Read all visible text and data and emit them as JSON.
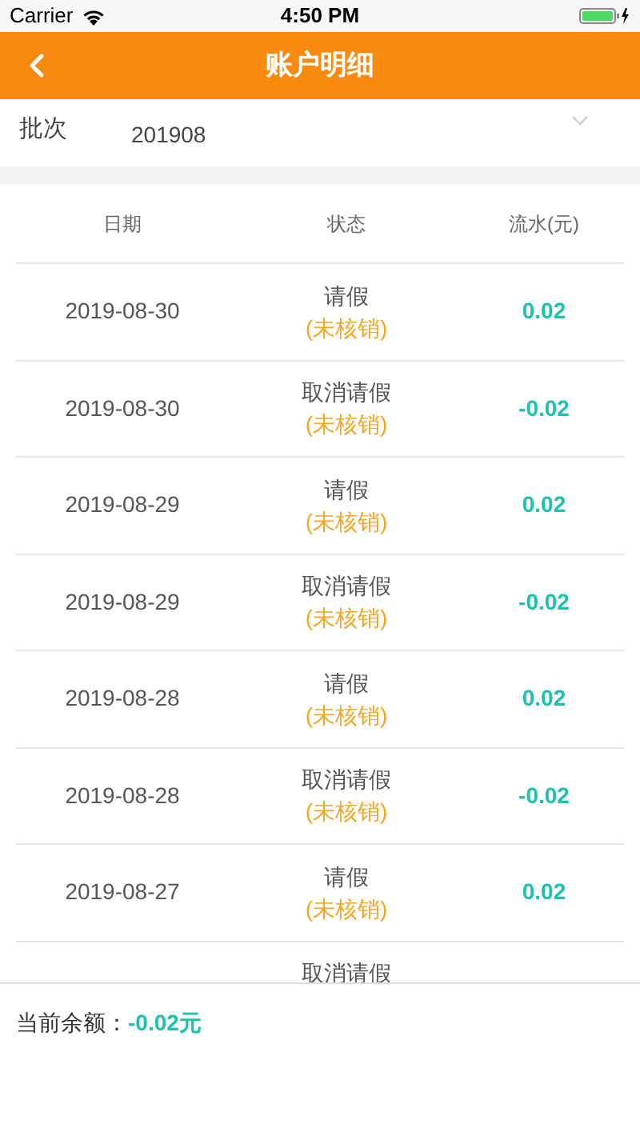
{
  "status_bar": {
    "carrier": "Carrier",
    "time": "4:50 PM"
  },
  "nav": {
    "title": "账户明细"
  },
  "batch": {
    "label": "批次",
    "value": "201908"
  },
  "table": {
    "columns": [
      "日期",
      "状态",
      "流水(元)"
    ],
    "rows": [
      {
        "date": "2019-08-30",
        "status": "请假",
        "note": "(未核销)",
        "amount": "0.02"
      },
      {
        "date": "2019-08-30",
        "status": "取消请假",
        "note": "(未核销)",
        "amount": "-0.02"
      },
      {
        "date": "2019-08-29",
        "status": "请假",
        "note": "(未核销)",
        "amount": "0.02"
      },
      {
        "date": "2019-08-29",
        "status": "取消请假",
        "note": "(未核销)",
        "amount": "-0.02"
      },
      {
        "date": "2019-08-28",
        "status": "请假",
        "note": "(未核销)",
        "amount": "0.02"
      },
      {
        "date": "2019-08-28",
        "status": "取消请假",
        "note": "(未核销)",
        "amount": "-0.02"
      },
      {
        "date": "2019-08-27",
        "status": "请假",
        "note": "(未核销)",
        "amount": "0.02"
      },
      {
        "status": "取消请假"
      }
    ]
  },
  "footer": {
    "label": "当前余额：",
    "balance": "-0.02元"
  }
}
